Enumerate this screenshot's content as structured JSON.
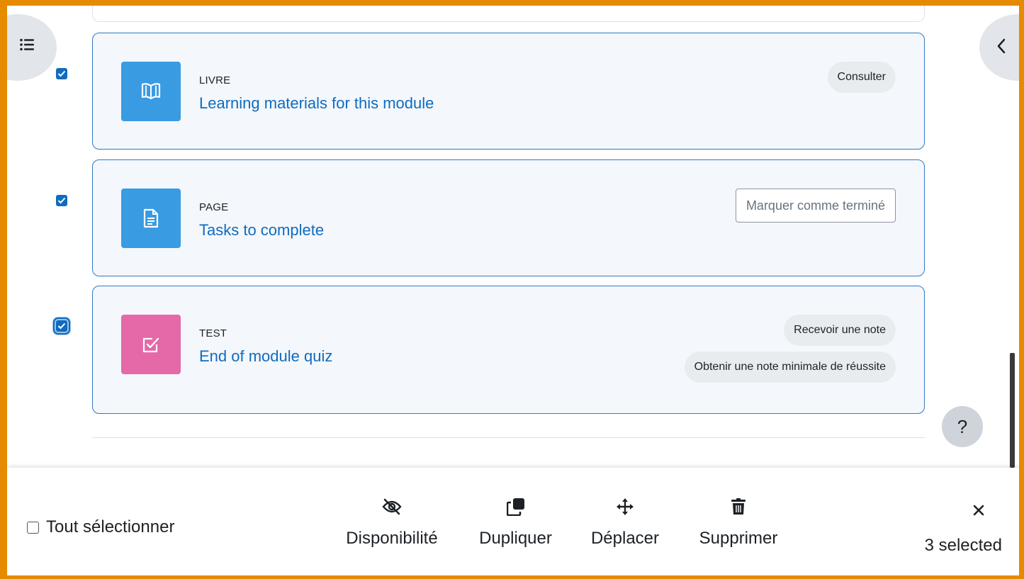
{
  "colors": {
    "frame_border": "#E68A00",
    "accent": "#0f6cbf",
    "book_icon_bg": "#399be2",
    "quiz_icon_bg": "#e568a8",
    "card_bg": "#f4f7fc"
  },
  "drawers": {
    "left_icon": "list-icon",
    "right_icon": "chevron-left-icon"
  },
  "activities": [
    {
      "checked": true,
      "type": "LIVRE",
      "name": "Learning materials for this module",
      "icon": "book-icon",
      "completion": [
        "Consulter"
      ]
    },
    {
      "checked": true,
      "type": "PAGE",
      "name": "Tasks to complete",
      "icon": "file-text-icon",
      "completion_button": "Marquer comme terminé"
    },
    {
      "checked": true,
      "type": "TEST",
      "name": "End of module quiz",
      "icon": "quiz-check-icon",
      "completion": [
        "Recevoir une note",
        "Obtenir une note minimale de réussite"
      ]
    }
  ],
  "help": {
    "label": "?"
  },
  "bulk": {
    "select_all": "Tout sélectionner",
    "actions": [
      {
        "label": "Disponibilité",
        "icon": "eye-slash-icon"
      },
      {
        "label": "Dupliquer",
        "icon": "copy-icon"
      },
      {
        "label": "Déplacer",
        "icon": "move-arrows-icon"
      },
      {
        "label": "Supprimer",
        "icon": "trash-icon"
      }
    ],
    "selected_count": "3 selected"
  }
}
